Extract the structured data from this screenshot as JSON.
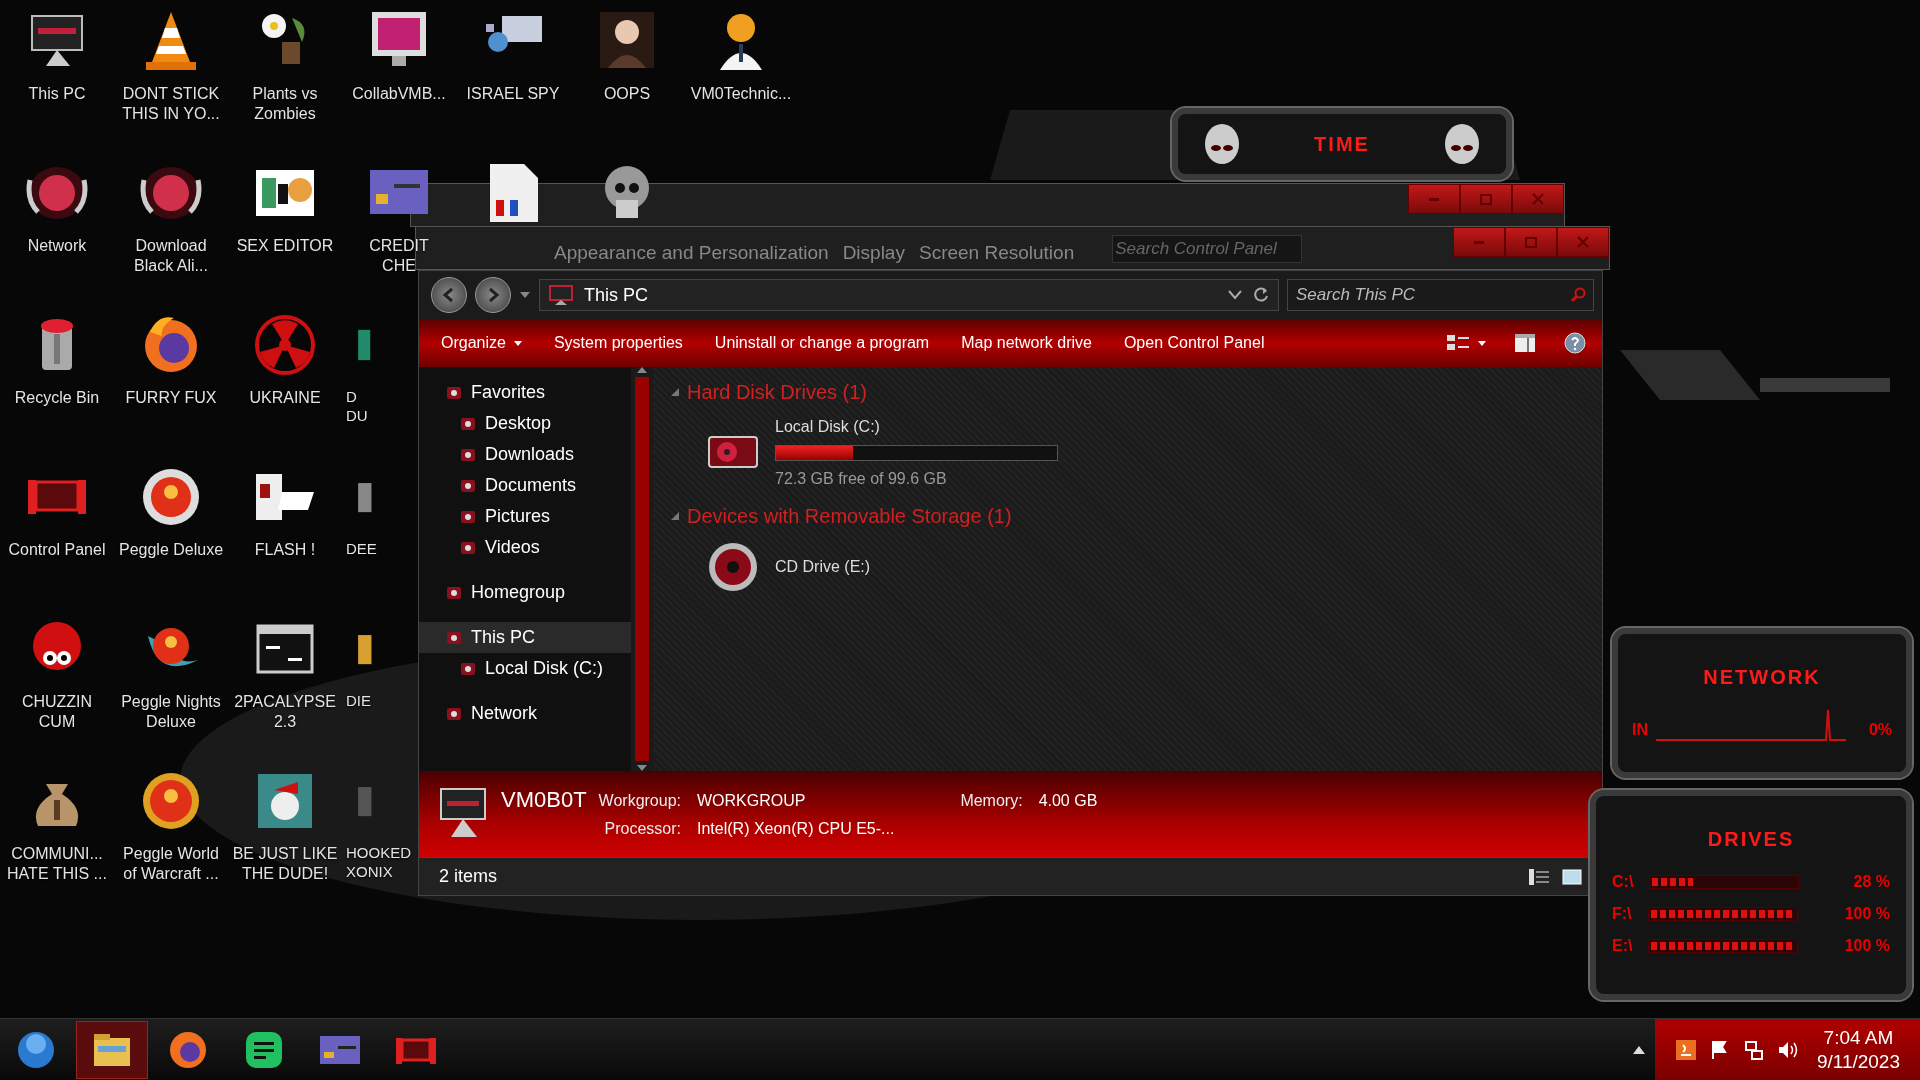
{
  "desktop_icons": [
    {
      "label": "This PC"
    },
    {
      "label": "Network"
    },
    {
      "label": "Recycle Bin"
    },
    {
      "label": "Control Panel"
    },
    {
      "label": "CHUZZIN\nCUM"
    },
    {
      "label": "COMMUNI...\nHATE THIS ..."
    },
    {
      "label": "DONT STICK\nTHIS IN YO..."
    },
    {
      "label": "Download\nBlack Ali..."
    },
    {
      "label": "FURRY FUX"
    },
    {
      "label": "Peggle Deluxe"
    },
    {
      "label": "Peggle Nights\nDeluxe"
    },
    {
      "label": "Peggle World\nof Warcraft ..."
    },
    {
      "label": "Plants vs\nZombies"
    },
    {
      "label": "SEX EDITOR"
    },
    {
      "label": "UKRAINE"
    },
    {
      "label": "FLASH !"
    },
    {
      "label": "2PACALYPSE\n2.3"
    },
    {
      "label": "BE JUST LIKE\nTHE DUDE!"
    },
    {
      "label": "CollabVMB..."
    },
    {
      "label": "CREDIT\nCHE"
    },
    {
      "label": "D\nDU"
    },
    {
      "label": "DEE"
    },
    {
      "label": "DIE"
    },
    {
      "label": "HOOKED\nXONIX"
    },
    {
      "label": "ISRAEL SPY"
    },
    {
      "kind": "shortcut"
    },
    {
      "label": "OOPS"
    },
    {
      "kind": "shortcut"
    },
    {
      "label": "VM0Technic..."
    }
  ],
  "ghost_windows": [
    {
      "kind": "bar"
    },
    {
      "kind": "control_panel",
      "breadcrumbs": [
        "Appearance and Personalization",
        "Display",
        "Screen Resolution"
      ],
      "search": {
        "placeholder": "Search Control Panel"
      }
    }
  ],
  "explorer": {
    "address": "This PC",
    "search": {
      "placeholder": "Search This PC"
    },
    "toolbar": [
      {
        "label": "Organize",
        "dropdown": true
      },
      {
        "label": "System properties",
        "dropdown": false
      },
      {
        "label": "Uninstall or change a program",
        "dropdown": false
      },
      {
        "label": "Map network drive",
        "dropdown": false
      },
      {
        "label": "Open Control Panel",
        "dropdown": false
      }
    ],
    "nav": [
      {
        "label": "Favorites",
        "selected": false,
        "children": [
          {
            "label": "Desktop",
            "selected": false
          },
          {
            "label": "Downloads",
            "selected": false
          },
          {
            "label": "Documents",
            "selected": false
          },
          {
            "label": "Pictures",
            "selected": false
          },
          {
            "label": "Videos",
            "selected": false
          }
        ]
      },
      {
        "label": "Homegroup",
        "selected": false
      },
      {
        "label": "This PC",
        "selected": true,
        "children": [
          {
            "label": "Local Disk (C:)",
            "selected": false
          }
        ]
      },
      {
        "label": "Network",
        "selected": false
      }
    ],
    "groups": [
      {
        "title": "Hard Disk Drives (1)",
        "items": [
          {
            "kind": "disk",
            "name": "Local Disk (C:)",
            "level": 0.274,
            "space": "72.3 GB free of 99.6 GB"
          }
        ]
      },
      {
        "title": "Devices with Removable Storage (1)",
        "items": [
          {
            "kind": "cd",
            "name": "CD Drive (E:)"
          }
        ]
      }
    ],
    "details": {
      "name": "VM0B0T",
      "fields": [
        {
          "label": "Workgroup:",
          "value": "WORKGROUP"
        },
        {
          "label": "Memory:",
          "value": "4.00 GB"
        },
        {
          "label": "Processor:",
          "value": "Intel(R) Xeon(R) CPU E5-..."
        }
      ]
    },
    "status": "2 items"
  },
  "gadgets": {
    "time": {
      "title": "TIME"
    },
    "network": {
      "title": "NETWORK",
      "label": "IN",
      "reading": "0%"
    },
    "drives": {
      "title": "DRIVES",
      "rows": [
        {
          "label": "C:\\",
          "level": 0.28,
          "reading": "28 %"
        },
        {
          "label": "F:\\",
          "level": 1,
          "reading": "100 %"
        },
        {
          "label": "E:\\",
          "level": 1,
          "reading": "100 %"
        }
      ]
    }
  },
  "taskbar": {
    "items": [
      {
        "kind": "folder",
        "active": true
      },
      {
        "kind": "browser",
        "active": false
      },
      {
        "kind": "notes",
        "active": false
      },
      {
        "kind": "card",
        "active": false
      },
      {
        "kind": "panel",
        "active": false
      }
    ],
    "time": "7:04 AM",
    "date": "9/11/2023"
  }
}
